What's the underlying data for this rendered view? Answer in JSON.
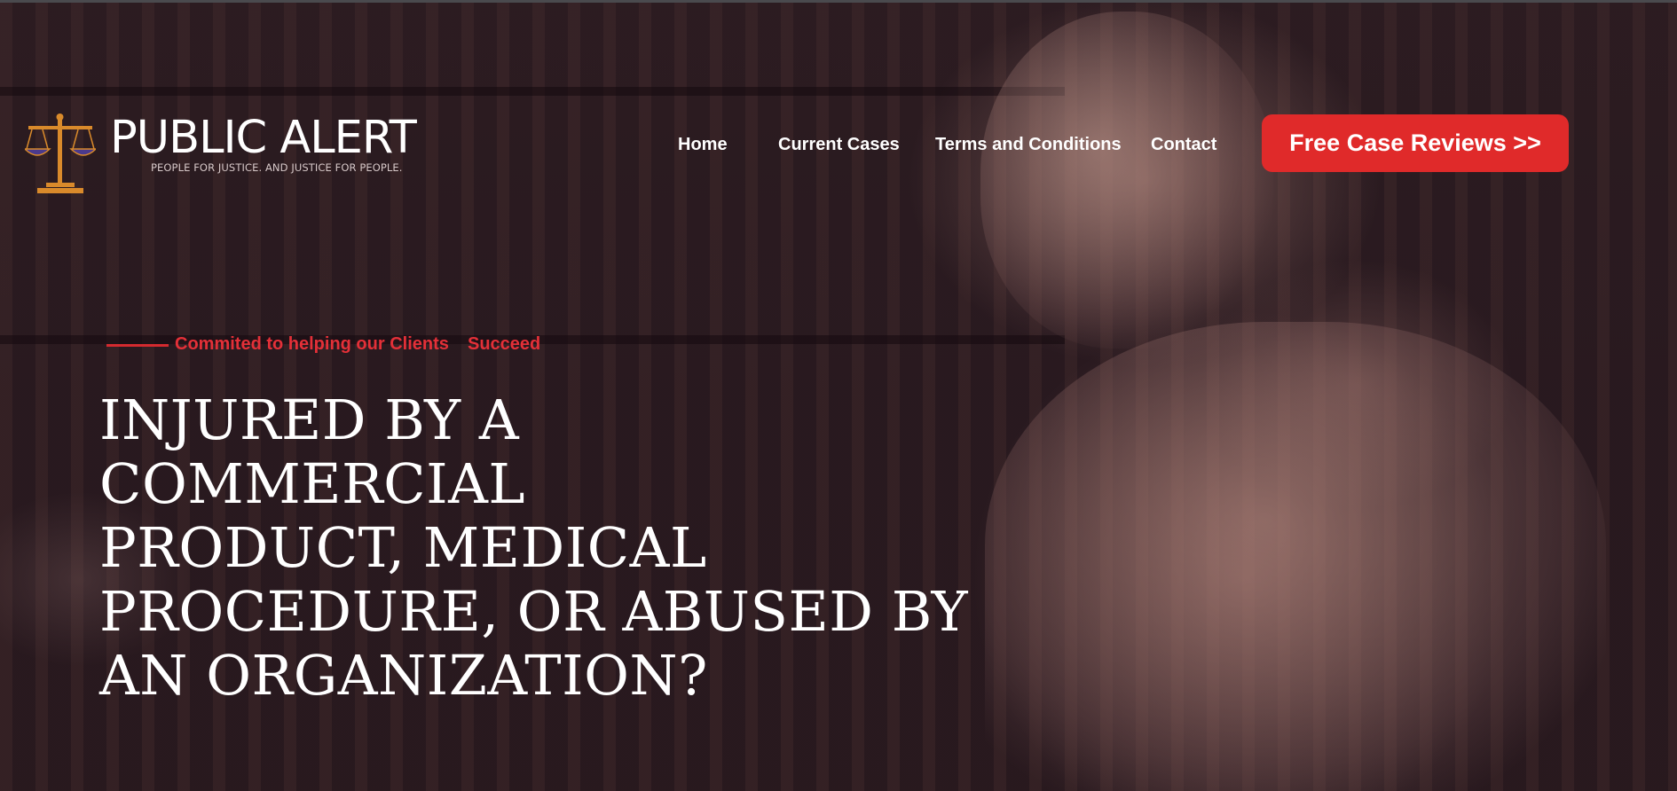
{
  "brand": {
    "name": "PUBLIC ALERT",
    "tagline": "PEOPLE FOR JUSTICE. AND JUSTICE FOR PEOPLE."
  },
  "nav": {
    "items": [
      {
        "label": "Home"
      },
      {
        "label": "Current Cases"
      },
      {
        "label": "Terms and Conditions"
      },
      {
        "label": "Contact"
      }
    ],
    "cta_label": "Free Case Reviews >>"
  },
  "hero": {
    "tagline_part1": "Commited to helping our Clients",
    "tagline_part2": "Succeed",
    "headline_lines": [
      "INJURED BY A",
      "COMMERCIAL",
      "PRODUCT, MEDICAL",
      "PROCEDURE, OR ABUSED BY",
      "AN ORGANIZATION?"
    ]
  },
  "colors": {
    "accent": "#e02a2a",
    "background": "#2a1a1f",
    "text": "#ffffff",
    "logo_gold": "#d98a2b",
    "logo_purple": "#4b3a8c"
  },
  "icons": {
    "logo": "scales-of-justice-icon"
  }
}
